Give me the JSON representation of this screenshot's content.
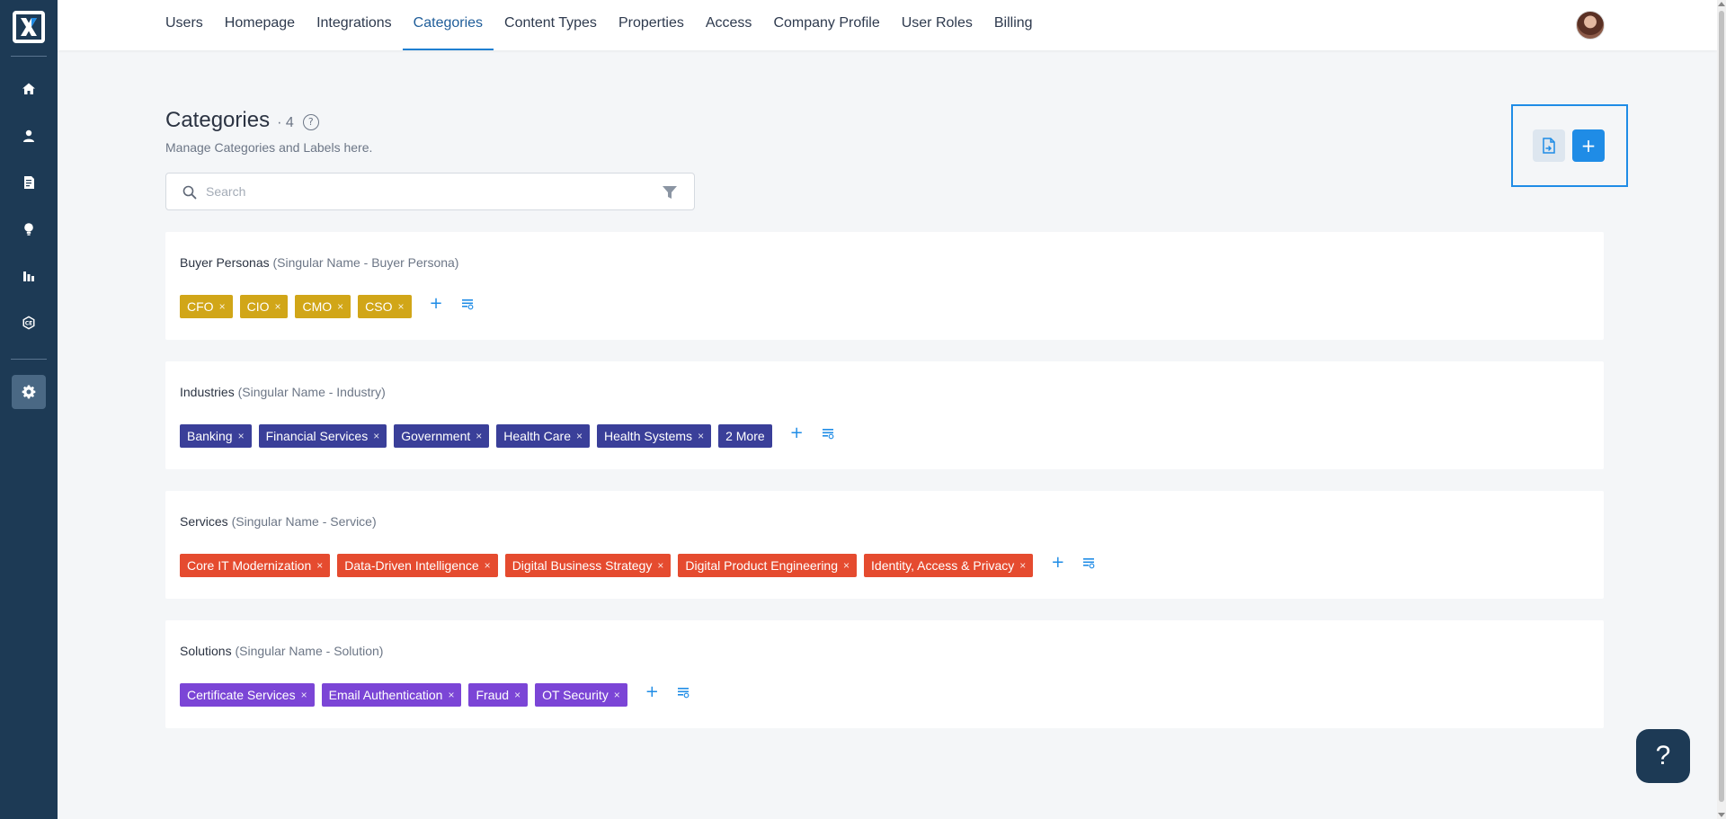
{
  "sidebar": {
    "logo_text": "X",
    "items": [
      {
        "icon": "home-icon"
      },
      {
        "icon": "user-icon"
      },
      {
        "icon": "document-icon"
      },
      {
        "icon": "lightbulb-icon"
      },
      {
        "icon": "bar-chart-icon"
      },
      {
        "icon": "ce-badge-icon"
      },
      {
        "icon": "gear-icon",
        "active": true
      }
    ]
  },
  "topnav": {
    "items": [
      {
        "label": "Users"
      },
      {
        "label": "Homepage"
      },
      {
        "label": "Integrations"
      },
      {
        "label": "Categories",
        "active": true
      },
      {
        "label": "Content Types"
      },
      {
        "label": "Properties"
      },
      {
        "label": "Access"
      },
      {
        "label": "Company Profile"
      },
      {
        "label": "User Roles"
      },
      {
        "label": "Billing"
      }
    ]
  },
  "page": {
    "title": "Categories",
    "count": "· 4",
    "help_glyph": "?",
    "subtitle": "Manage Categories and Labels here."
  },
  "search": {
    "placeholder": "Search",
    "value": ""
  },
  "actions": {
    "add_glyph": "+"
  },
  "categories": [
    {
      "name": "Buyer Personas",
      "singular": "(Singular Name - Buyer Persona)",
      "color": "#d1a618",
      "tags": [
        "CFO",
        "CIO",
        "CMO",
        "CSO"
      ]
    },
    {
      "name": "Industries",
      "singular": "(Singular Name - Industry)",
      "color": "#3a3f99",
      "tags": [
        "Banking",
        "Financial Services",
        "Government",
        "Health Care",
        "Health Systems"
      ],
      "more": "2 More"
    },
    {
      "name": "Services",
      "singular": "(Singular Name - Service)",
      "color": "#e54b2f",
      "tags": [
        "Core IT Modernization",
        "Data-Driven Intelligence",
        "Digital Business Strategy",
        "Digital Product Engineering",
        "Identity, Access & Privacy"
      ]
    },
    {
      "name": "Solutions",
      "singular": "(Singular Name - Solution)",
      "color": "#7b45d6",
      "tags": [
        "Certificate Services",
        "Email Authentication",
        "Fraud",
        "OT Security"
      ]
    }
  ],
  "tag_remove_glyph": "×",
  "tag_add_glyph": "+",
  "help_fab": "?"
}
